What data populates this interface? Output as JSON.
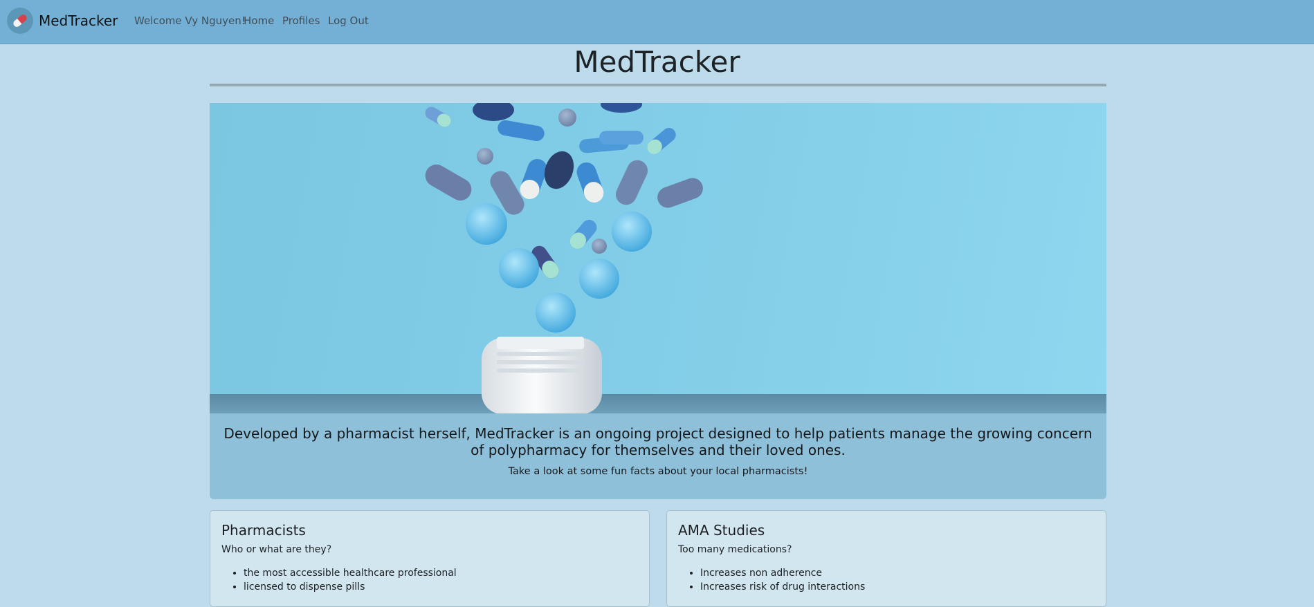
{
  "navbar": {
    "brand": "MedTracker",
    "welcome": "Welcome Vy Nguyen!",
    "links": [
      "Home",
      "Profiles",
      "Log Out"
    ],
    "logo_icon": "pill-capsule-icon"
  },
  "page": {
    "title": "MedTracker"
  },
  "hero": {
    "image_icon": "pills-bottle-image"
  },
  "jumbotron": {
    "lead": "Developed by a pharmacist herself, MedTracker is an ongoing project designed to help patients manage the growing concern of polypharmacy for themselves and their loved ones.",
    "sub": "Take a look at some fun facts about your local pharmacists!"
  },
  "cards": [
    {
      "title": "Pharmacists",
      "subtitle": "Who or what are they?",
      "items": [
        "the most accessible healthcare professional",
        "licensed to dispense pills"
      ]
    },
    {
      "title": "AMA Studies",
      "subtitle": "Too many medications?",
      "items": [
        "Increases non adherence",
        "Increases risk of drug interactions"
      ]
    }
  ],
  "colors": {
    "navbar": "#74b0d5",
    "page_background": "#bddbea",
    "jumbotron": "#8fc0da",
    "card": "#d2e6f0"
  }
}
